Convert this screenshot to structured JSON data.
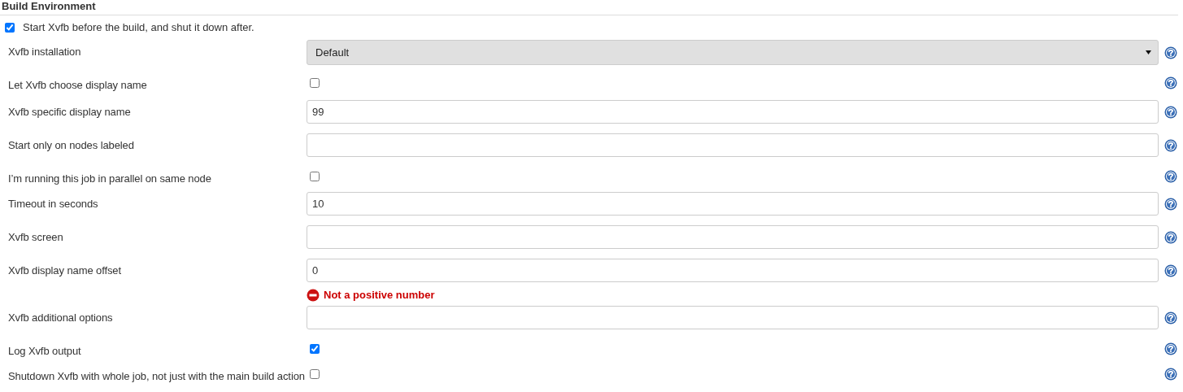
{
  "section": {
    "title": "Build Environment"
  },
  "master": {
    "label": "Start Xvfb before the build, and shut it down after.",
    "checked": true
  },
  "fields": [
    {
      "kind": "select",
      "label": "Xvfb installation",
      "value": "Default"
    },
    {
      "kind": "checkbox",
      "label": "Let Xvfb choose display name",
      "checked": false
    },
    {
      "kind": "text",
      "label": "Xvfb specific display name",
      "value": "99"
    },
    {
      "kind": "text",
      "label": "Start only on nodes labeled"
    },
    {
      "kind": "checkbox",
      "label": "I’m running this job in parallel on same node",
      "checked": false
    },
    {
      "kind": "text",
      "label": "Timeout in seconds",
      "value": "10"
    },
    {
      "kind": "text",
      "label": "Xvfb screen"
    },
    {
      "kind": "text",
      "label": "Xvfb display name offset",
      "value": "0",
      "error": "Not a positive number"
    },
    {
      "kind": "text",
      "label": "Xvfb additional options"
    },
    {
      "kind": "checkbox",
      "label": "Log Xvfb output",
      "checked": true
    },
    {
      "kind": "checkbox",
      "label": "Shutdown Xvfb with whole job, not just with the main build action",
      "checked": false
    }
  ]
}
